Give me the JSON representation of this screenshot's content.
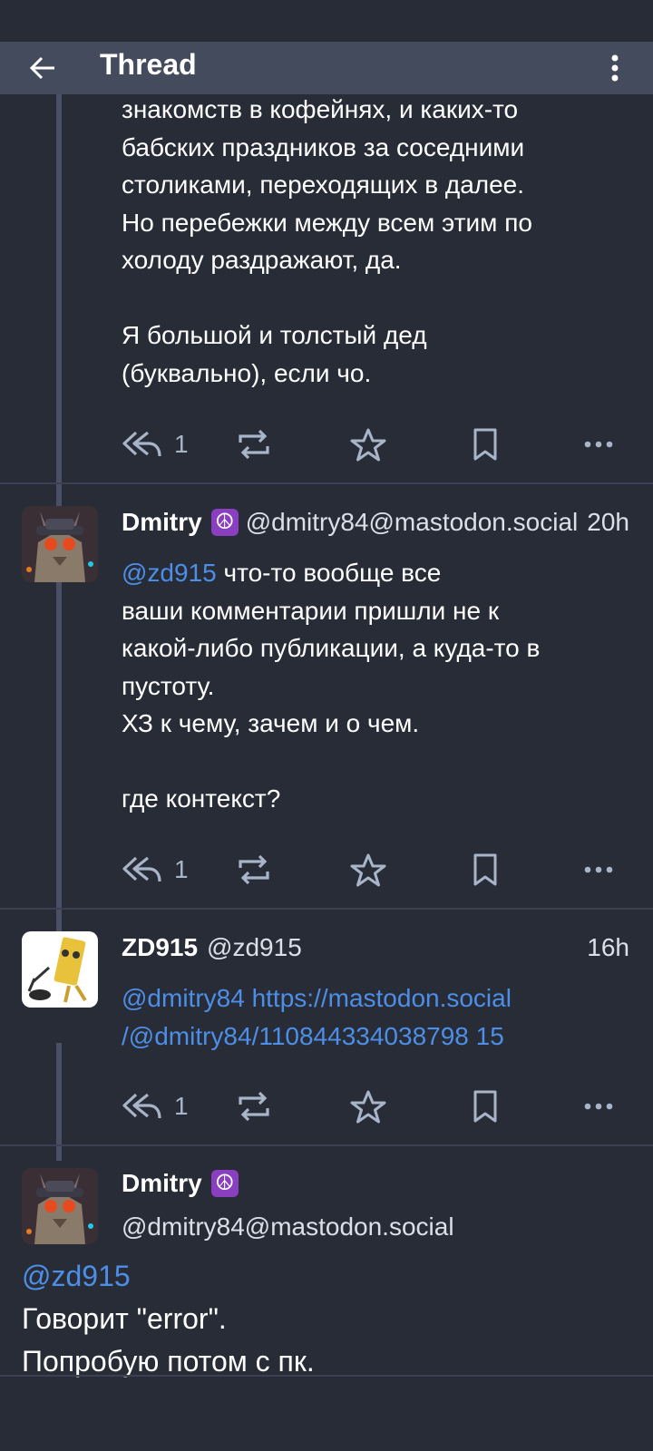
{
  "appbar": {
    "title": "Thread",
    "back_icon": "arrow-left-icon",
    "menu_icon": "more-vertical-icon"
  },
  "colors": {
    "background": "#282c37",
    "appbar": "#444b5d",
    "mention": "#4d8ee6",
    "icon": "#a8b4c8"
  },
  "posts": [
    {
      "text": "знакомств в кофейнях, и каких-то\nбабских праздников за соседними\nстоликами, переходящих в далее.\nНо перебежки между всем этим по\nхолоду раздражают, да.\n\nЯ большой и толстый дед\n(буквально), если чо.",
      "reply_count": "1"
    },
    {
      "display_name": "Dmitry",
      "emoji": "☮",
      "handle": "@dmitry84@mastodon.social",
      "time": "20h",
      "mention": "@zd915",
      "text": " что-то вообще все\nваши комментарии пришли не к\nкакой-либо публикации, а куда-то в\nпустоту.\nХЗ к чему, зачем и о чем.\n\nгде контекст?",
      "reply_count": "1"
    },
    {
      "display_name": "ZD915",
      "handle": "@zd915",
      "time": "16h",
      "mention": "@dmitry84",
      "link": " https://mastodon.social\n/@dmitry84/110844334038798 15",
      "reply_count": "1"
    },
    {
      "display_name": "Dmitry",
      "emoji": "☮",
      "handle": "@dmitry84@mastodon.social",
      "mention": "@zd915",
      "text": "Говорит \"error\".\nПопробую потом с пк."
    }
  ]
}
